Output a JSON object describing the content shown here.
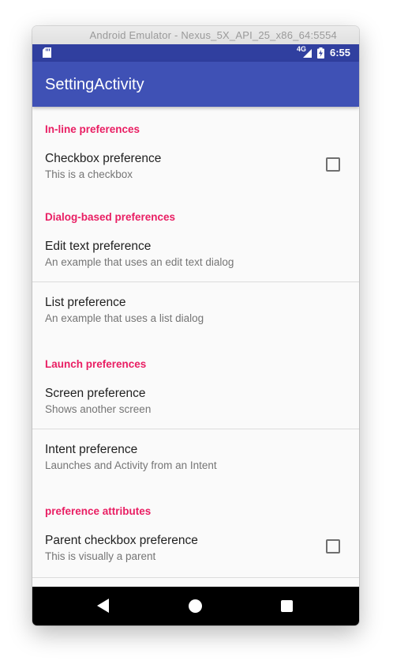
{
  "window": {
    "title": "Android Emulator - Nexus_5X_API_25_x86_64:5554"
  },
  "status_bar": {
    "network": "4G",
    "time": "6:55",
    "color": "#303f9f"
  },
  "app_bar": {
    "title": "SettingActivity",
    "color": "#3f51b5"
  },
  "accent_color": "#e91e63",
  "sections": {
    "inline": {
      "header": "In-line preferences",
      "checkbox_pref": {
        "title": "Checkbox preference",
        "summary": "This is a checkbox",
        "checked": false
      }
    },
    "dialog": {
      "header": "Dialog-based preferences",
      "edit_text_pref": {
        "title": "Edit text preference",
        "summary": "An example that uses an edit text dialog"
      },
      "list_pref": {
        "title": "List preference",
        "summary": "An example that uses a list dialog"
      }
    },
    "launch": {
      "header": "Launch preferences",
      "screen_pref": {
        "title": "Screen preference",
        "summary": "Shows another screen"
      },
      "intent_pref": {
        "title": "Intent preference",
        "summary": "Launches and Activity from an Intent"
      }
    },
    "attributes": {
      "header": "preference attributes",
      "parent_checkbox_pref": {
        "title": "Parent checkbox preference",
        "summary": "This is visually a parent",
        "checked": false
      }
    }
  },
  "nav_bar": {
    "back_icon": "triangle-back-icon",
    "home_icon": "circle-home-icon",
    "recents_icon": "square-recents-icon"
  }
}
